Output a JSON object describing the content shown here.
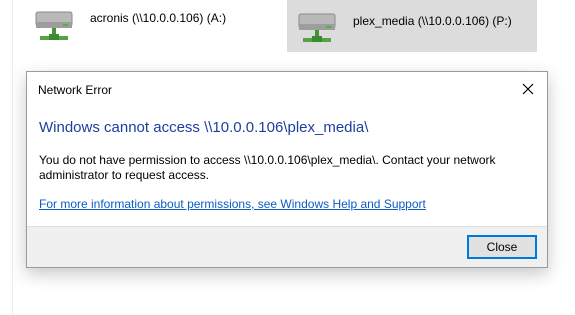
{
  "drives": [
    {
      "label": "acronis (\\\\10.0.0.106) (A:)",
      "icon": "network-drive-icon",
      "selected": false
    },
    {
      "label": "plex_media (\\\\10.0.0.106) (P:)",
      "icon": "network-drive-icon",
      "selected": true
    }
  ],
  "dialog": {
    "title": "Network Error",
    "main_instruction": "Windows cannot access \\\\10.0.0.106\\plex_media\\",
    "content": "You do not have permission to access \\\\10.0.0.106\\plex_media\\. Contact your network administrator to request access.",
    "help_link": "For more information about permissions, see Windows Help and Support",
    "close_button": "Close",
    "close_icon": "close-icon"
  },
  "colors": {
    "instruction_blue": "#1c3f9f",
    "link_blue": "#0b5cc4",
    "button_focus": "#0078d7",
    "selection": "#dcdcdc"
  }
}
